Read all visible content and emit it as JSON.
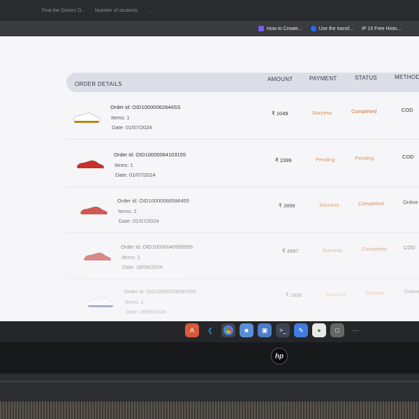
{
  "browser": {
    "tabs": [
      "Find the District O...",
      "Number of students",
      "..."
    ],
    "bookmarks": [
      {
        "label": "How to Create...",
        "color": "#7a5cff"
      },
      {
        "label": "Use the transf...",
        "color": "#1e6cff"
      },
      {
        "label": "IP  15 Free Histo...",
        "color": "#ffffff"
      }
    ]
  },
  "table": {
    "headers": {
      "details": "ORDER DETAILS",
      "amount": "AMOUNT",
      "payment": "PAYMENT",
      "status": "STATUS",
      "method": "METHOD"
    },
    "rows": [
      {
        "order_id": "Order id: OID10000062844SS",
        "items": "Items: 1",
        "date": "Date: 01/07/2024",
        "amount": "₹ 1049",
        "payment": "Success",
        "status": "Completed",
        "method": "COD",
        "shoe_color": "#ffffff",
        "shoe_accent": "#b8860b"
      },
      {
        "order_id": "Order id: OID10000064103155",
        "items": "Items: 1",
        "date": "Date: 01/07/2024",
        "amount": "₹ 2399",
        "payment": "Pending",
        "status": "Pending",
        "method": "COD",
        "shoe_color": "#c8302a",
        "shoe_accent": "#ffffff"
      },
      {
        "order_id": "Order id: OID10000066596455",
        "items": "Items: 2",
        "date": "Date: 01/07/2024",
        "amount": "₹ 3898",
        "payment": "Success",
        "status": "Completed",
        "method": "Online",
        "shoe_color": "#c8302a",
        "shoe_accent": "#ffffff"
      },
      {
        "order_id": "Order id: OID10000040955055",
        "items": "Items: 2",
        "date": "Date: 28/06/2024",
        "amount": "₹ 4997",
        "payment": "Success",
        "status": "Completed",
        "method": "COD",
        "shoe_color": "#c8302a",
        "shoe_accent": "#ffffff"
      },
      {
        "order_id": "Order id: OID10000026091655",
        "items": "Items: 1",
        "date": "Date: 28/06/2024",
        "amount": "₹ 1899",
        "payment": "Success",
        "status": "Created",
        "method": "Online",
        "shoe_color": "#ffffff",
        "shoe_accent": "#1a2a6c"
      }
    ]
  },
  "colors": {
    "success": "#c98a4a",
    "pending": "#d8955a",
    "completed": "#c9703a"
  },
  "dock_apps": [
    "files-icon",
    "vscode-icon",
    "chrome-icon",
    "folder-icon",
    "photos-icon",
    "terminal-icon",
    "notes-icon",
    "mongodb-icon",
    "store-icon",
    "launcher-icon"
  ],
  "brand": "hp"
}
